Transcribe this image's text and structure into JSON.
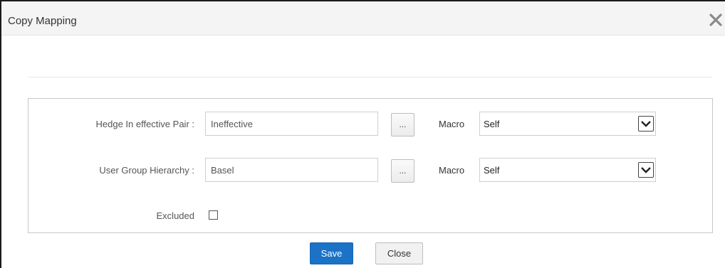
{
  "dialog": {
    "title": "Copy Mapping",
    "close_icon": "close-x-icon"
  },
  "form": {
    "rows": [
      {
        "label": "Hedge In effective Pair :",
        "value": "Ineffective",
        "browse_label": "...",
        "macro_label": "Macro",
        "macro_value": "Self"
      },
      {
        "label": "User Group Hierarchy :",
        "value": "Basel",
        "browse_label": "...",
        "macro_label": "Macro",
        "macro_value": "Self"
      }
    ],
    "excluded_label": "Excluded",
    "excluded_checked": false
  },
  "footer": {
    "save_label": "Save",
    "close_label": "Close"
  },
  "colors": {
    "primary_button": "#1a73c7",
    "titlebar": "#f4f4f4"
  }
}
